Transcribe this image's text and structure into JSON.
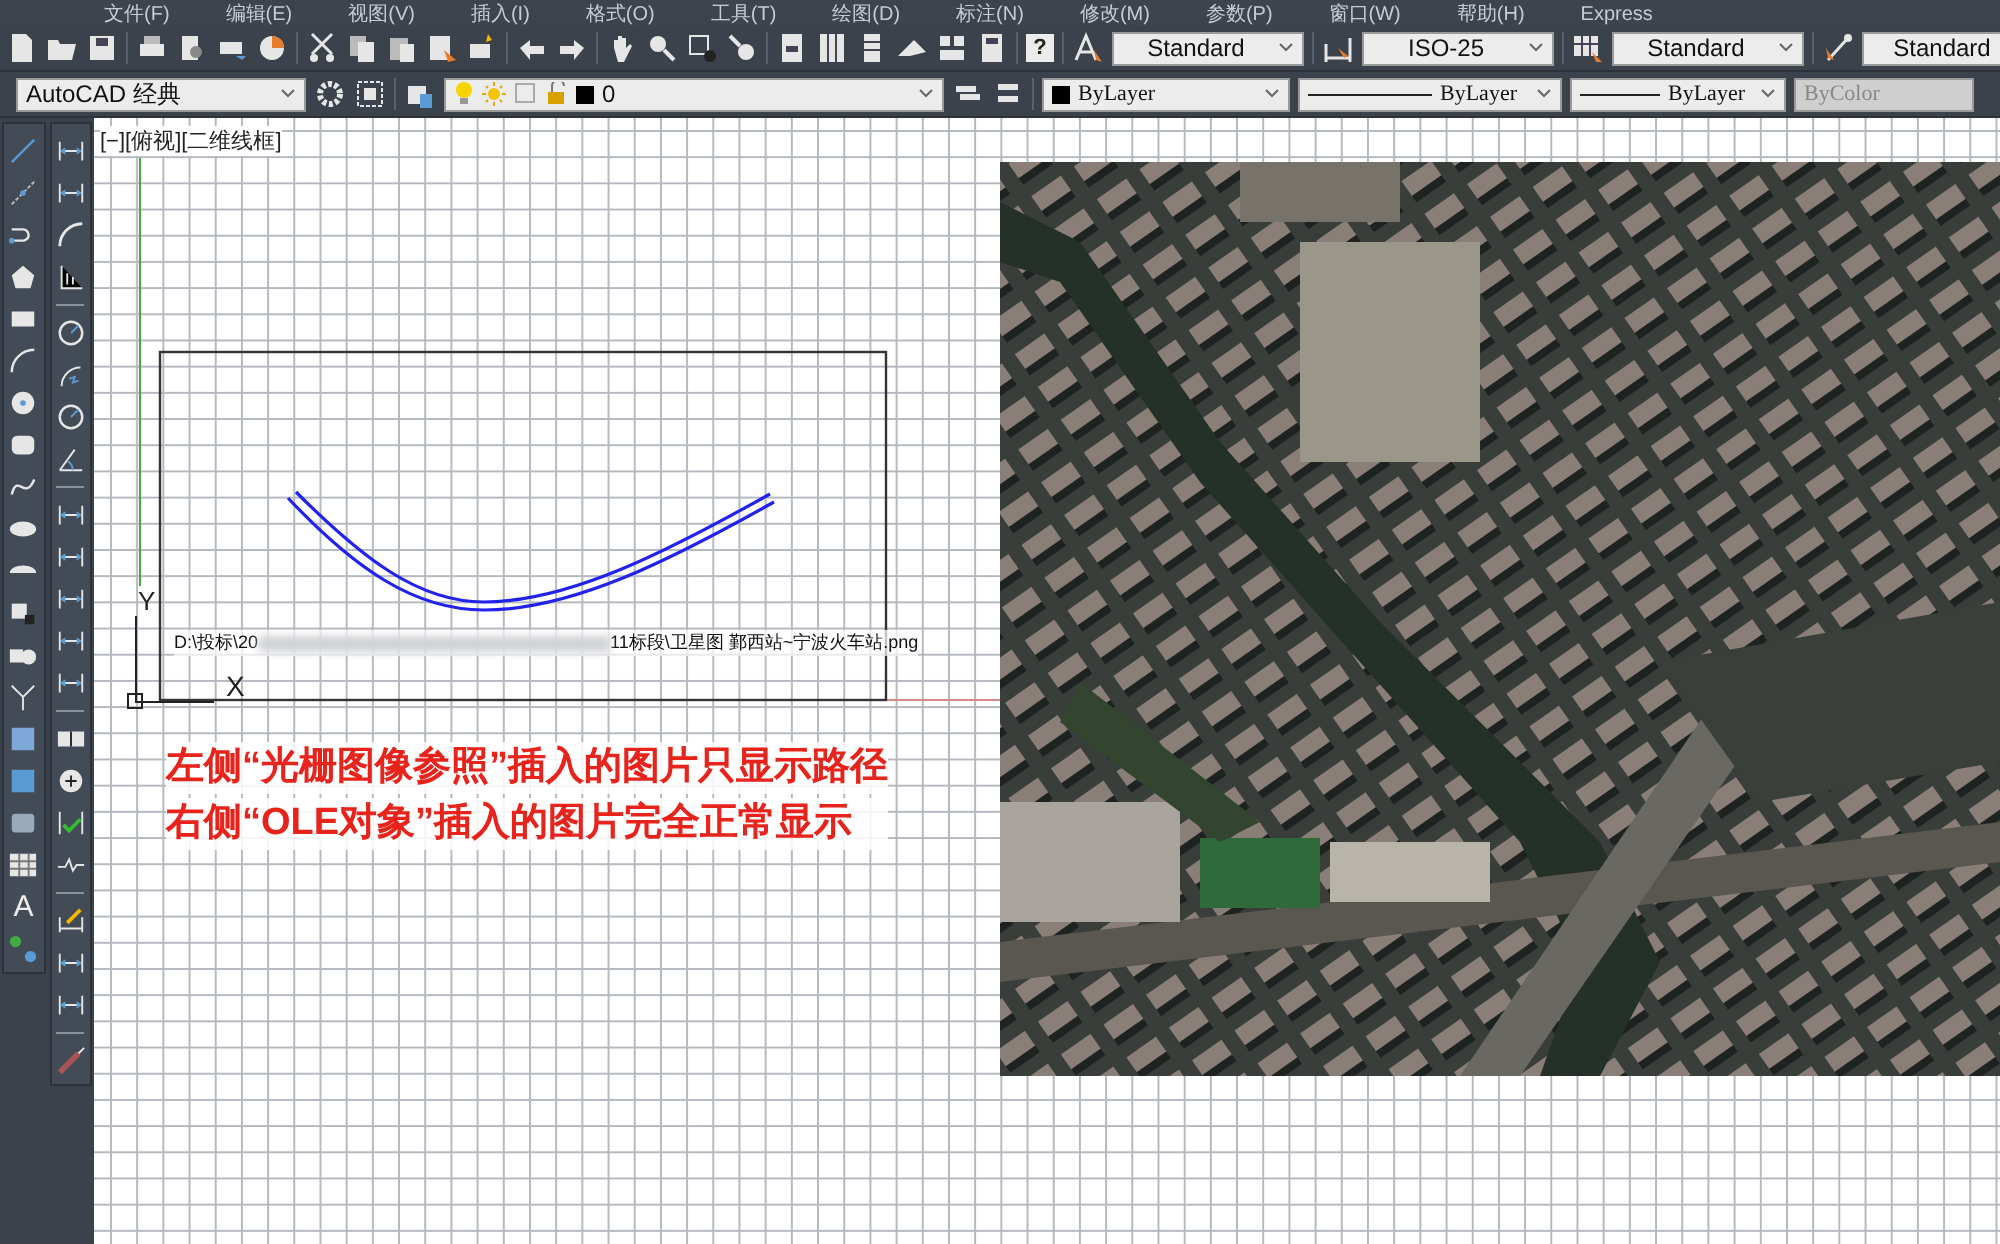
{
  "menu_bar": {
    "items": [
      "文件(F)",
      "编辑(E)",
      "视图(V)",
      "插入(I)",
      "格式(O)",
      "工具(T)",
      "绘图(D)",
      "标注(N)",
      "修改(M)",
      "参数(P)",
      "窗口(W)",
      "帮助(H)",
      "Express"
    ]
  },
  "toolbar_1": {
    "help_glyph": "?",
    "styles": [
      {
        "kind": "text",
        "value": "Standard"
      },
      {
        "kind": "dimension",
        "value": "ISO-25"
      },
      {
        "kind": "table",
        "value": "Standard"
      },
      {
        "kind": "multileader",
        "value": "Standard"
      }
    ]
  },
  "toolbar_2": {
    "workspace": "AutoCAD 经典",
    "layer": "0",
    "properties": [
      {
        "kind": "color",
        "value": "ByLayer",
        "disabled": false
      },
      {
        "kind": "linetype",
        "value": "ByLayer",
        "disabled": false
      },
      {
        "kind": "lineweight",
        "value": "ByLayer",
        "disabled": false
      },
      {
        "kind": "plotstyle",
        "value": "ByColor",
        "disabled": true
      }
    ]
  },
  "draw_toolbar": {
    "text_glyph": "A"
  },
  "viewport": {
    "label": "[−][俯视][二维线框]",
    "image_path": {
      "start": "D:\\投标\\20",
      "end": "11标段\\卫星图 鄞西站~宁波火车站.png"
    },
    "ucs": {
      "y_label": "Y",
      "x_label": "X"
    },
    "notes": [
      "左侧“光栅图像参照”插入的图片只显示路径",
      "右侧“OLE对象”插入的图片完全正常显示"
    ]
  }
}
